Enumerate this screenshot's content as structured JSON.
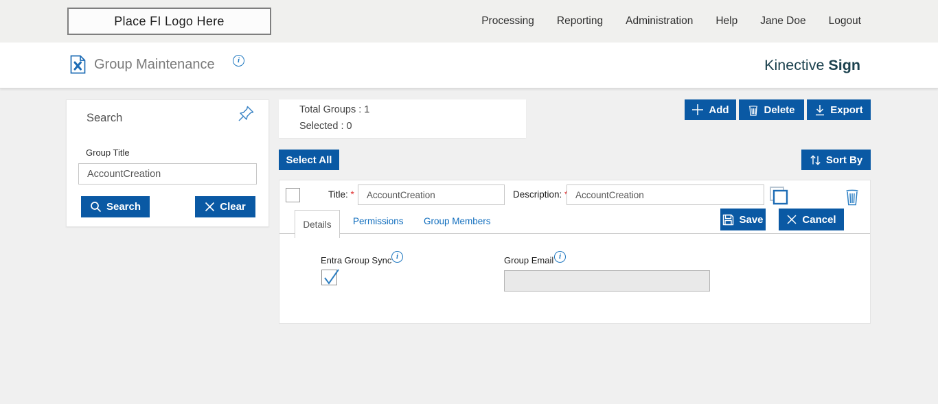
{
  "colors": {
    "primary_blue": "#0a59a4",
    "link_blue": "#0e6cbd",
    "icon_blue": "#2e7fc3",
    "brand_teal": "#1b414e",
    "required_red": "#e03030",
    "topbar_bg": "#f0f0ee",
    "content_bg": "#f0f0f0"
  },
  "topbar": {
    "logo_text": "Place FI Logo Here",
    "nav": [
      "Processing",
      "Reporting",
      "Administration",
      "Help",
      "Jane Doe",
      "Logout"
    ]
  },
  "header": {
    "title": "Group Maintenance",
    "info_glyph": "i",
    "brand": {
      "regular": "Kinective",
      "bold": "Sign"
    }
  },
  "search_panel": {
    "title": "Search",
    "group_title_label": "Group Title",
    "group_title_value": "AccountCreation",
    "search_button": "Search",
    "clear_button": "Clear"
  },
  "summary": {
    "total_groups": "Total Groups : 1",
    "selected": "Selected : 0"
  },
  "toolbar": {
    "add_label": "Add",
    "delete_label": "Delete",
    "export_label": "Export"
  },
  "list_actions": {
    "select_all_label": "Select All",
    "sort_by_label": "Sort By"
  },
  "group_row": {
    "checkbox_checked": false,
    "title_label": "Title:",
    "required_marker": "*",
    "title_value": "AccountCreation",
    "description_label": "Description:",
    "description_value": "AccountCreation",
    "tabs": [
      "Details",
      "Permissions",
      "Group Members"
    ],
    "active_tab": "Details",
    "save_label": "Save",
    "cancel_label": "Cancel",
    "details_tab": {
      "entra_group_sync_label": "Entra Group Sync",
      "entra_group_sync_checked": true,
      "info_glyph": "i",
      "group_email_label": "Group Email",
      "group_email_value": ""
    }
  }
}
